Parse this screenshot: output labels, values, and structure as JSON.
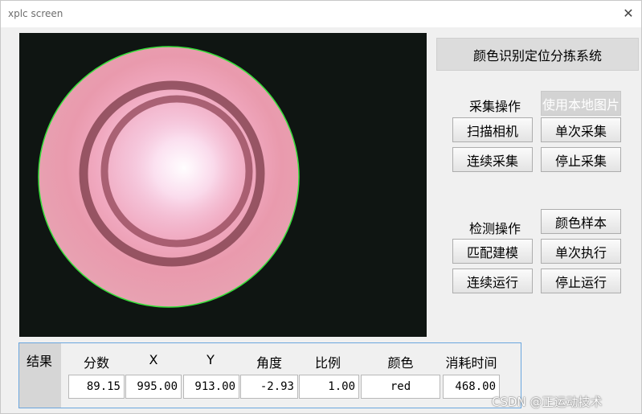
{
  "window": {
    "title": "xplc screen",
    "close_glyph": "✕"
  },
  "system_title": "颜色识别定位分拣系统",
  "acquisition": {
    "label": "采集操作",
    "local_image_button": "使用本地图片",
    "scan_camera_button": "扫描相机",
    "single_capture_button": "单次采集",
    "continuous_capture_button": "连续采集",
    "stop_capture_button": "停止采集"
  },
  "detection": {
    "label": "检测操作",
    "color_sample_button": "颜色样本",
    "match_model_button": "匹配建模",
    "single_execute_button": "单次执行",
    "continuous_run_button": "连续运行",
    "stop_run_button": "停止运行"
  },
  "results": {
    "label": "结果",
    "headers": [
      "分数",
      "X",
      "Y",
      "角度",
      "比例",
      "颜色",
      "消耗时间"
    ],
    "values": [
      "89.15",
      "995.00",
      "913.00",
      "-2.93",
      "1.00",
      "red",
      "468.00"
    ]
  },
  "image": {
    "object_color": "#f2a3b6",
    "outline_color": "#37e03a",
    "background_color": "#0f1512"
  },
  "watermark": "CSDN @正运动技术"
}
